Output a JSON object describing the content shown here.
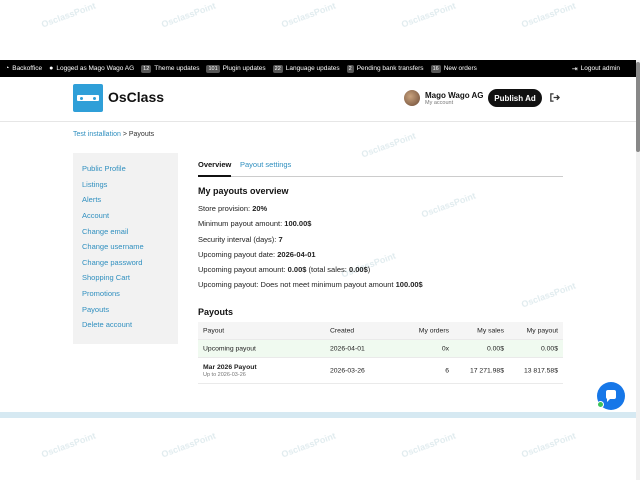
{
  "adminbar": {
    "backoffice": "Backoffice",
    "logged_as": "Logged as Mago Wago AG",
    "items": [
      {
        "badge": "12",
        "label": "Theme updates"
      },
      {
        "badge": "101",
        "label": "Plugin updates"
      },
      {
        "badge": "22",
        "label": "Language updates"
      },
      {
        "badge": "2",
        "label": "Pending bank transfers"
      },
      {
        "badge": "16",
        "label": "New orders"
      }
    ],
    "logout": "Logout admin"
  },
  "header": {
    "logo_text": "OsClass",
    "user_name": "Mago Wago AG",
    "user_sub": "My account",
    "publish_label": "Publish Ad"
  },
  "breadcrumb": {
    "home": "Test installation",
    "separator": ">",
    "current": "Payouts"
  },
  "sidebar": {
    "items": [
      "Public Profile",
      "Listings",
      "Alerts",
      "Account",
      "Change email",
      "Change username",
      "Change password",
      "Shopping Cart",
      "Promotions",
      "Payouts",
      "Delete account"
    ]
  },
  "tabs": {
    "overview": "Overview",
    "settings": "Payout settings"
  },
  "overview": {
    "title": "My payouts overview",
    "store_provision_label": "Store provision:",
    "store_provision_value": "20%",
    "min_payout_label": "Minimum payout amount:",
    "min_payout_value": "100.00$",
    "security_label": "Security interval (days):",
    "security_value": "7",
    "upcoming_date_label": "Upcoming payout date:",
    "upcoming_date_value": "2026-04-01",
    "upcoming_amount_label": "Upcoming payout amount:",
    "upcoming_amount_value": "0.00$",
    "upcoming_amount_total_pre": "(total sales:",
    "upcoming_amount_total_value": "0.00$",
    "upcoming_amount_total_post": ")",
    "upcoming_payout_label": "Upcoming payout: Does not meet minimum payout amount",
    "upcoming_payout_value": "100.00$"
  },
  "payouts": {
    "title": "Payouts",
    "headers": [
      "Payout",
      "Created",
      "My orders",
      "My sales",
      "My payout"
    ],
    "rows": [
      {
        "payout": "Upcoming payout",
        "sub": "",
        "created": "2026-04-01",
        "orders": "0x",
        "sales": "0.00$",
        "payout_amount": "0.00$"
      },
      {
        "payout": "Mar 2026 Payout",
        "sub": "Up to 2026-03-26",
        "created": "2026-03-26",
        "orders": "6",
        "sales": "17 271.98$",
        "payout_amount": "13 817.58$"
      }
    ]
  },
  "watermark": "OsclassPoint",
  "colors": {
    "accent": "#2f8fbf",
    "logo": "#2f9fd8",
    "adminbar": "#000000",
    "chat": "#1677e8"
  }
}
